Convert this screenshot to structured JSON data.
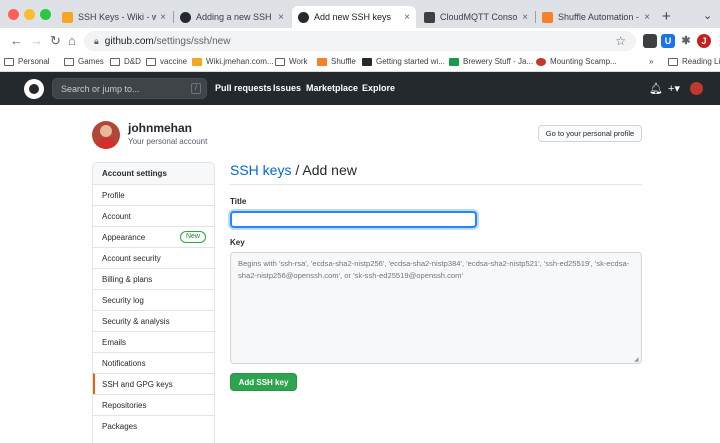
{
  "browser": {
    "tabs": [
      {
        "label": "SSH Keys - Wiki - wiki.jme",
        "icon_color": "#f5a623"
      },
      {
        "label": "Adding a new SSH key to y",
        "icon_color": "#24292e"
      },
      {
        "label": "Add new SSH keys",
        "icon_color": "#24292e",
        "active": true
      },
      {
        "label": "CloudMQTT Console mikh",
        "icon_color": "#3c4043"
      },
      {
        "label": "Shuffle Automation - An O",
        "icon_color": "#f5822a"
      }
    ],
    "close_glyph": "×",
    "new_tab_glyph": "+",
    "url_host": "github.com",
    "url_path": "/settings/ssh/new",
    "bookmarks": [
      {
        "label": "Personal",
        "kind": "folder"
      },
      {
        "label": "Games",
        "kind": "folder"
      },
      {
        "label": "D&D",
        "kind": "folder"
      },
      {
        "label": "vaccine",
        "kind": "folder"
      },
      {
        "label": "Wiki.jmehan.com...",
        "kind": "site",
        "color": "#f5a623"
      },
      {
        "label": "Work",
        "kind": "folder"
      },
      {
        "label": "Shuffle",
        "kind": "site",
        "color": "#f5822a"
      },
      {
        "label": "Getting started wi...",
        "kind": "site",
        "color": "#24292e"
      },
      {
        "label": "Brewery Stuff - Ja...",
        "kind": "site",
        "color": "#1a9b4b"
      },
      {
        "label": "Mounting Scamp...",
        "kind": "site",
        "color": "#c0392b"
      }
    ],
    "bookmarks_overflow": "»",
    "reading_list": "Reading List",
    "profile_initial": "J"
  },
  "github": {
    "search_placeholder": "Search or jump to...",
    "search_shortcut": "/",
    "nav": [
      "Pull requests",
      "Issues",
      "Marketplace",
      "Explore"
    ],
    "accent": "#0366d6"
  },
  "profile": {
    "username": "johnmehan",
    "subtitle": "Your personal account",
    "profile_button": "Go to your personal profile"
  },
  "sidebar": {
    "header": "Account settings",
    "items": [
      {
        "label": "Profile"
      },
      {
        "label": "Account"
      },
      {
        "label": "Appearance",
        "badge": "New"
      },
      {
        "label": "Account security"
      },
      {
        "label": "Billing & plans"
      },
      {
        "label": "Security log"
      },
      {
        "label": "Security & analysis"
      },
      {
        "label": "Emails"
      },
      {
        "label": "Notifications"
      },
      {
        "label": "SSH and GPG keys",
        "selected": true
      },
      {
        "label": "Repositories"
      },
      {
        "label": "Packages"
      }
    ]
  },
  "form": {
    "breadcrumb_link": "SSH keys",
    "breadcrumb_rest": " / Add new",
    "title_label": "Title",
    "title_value": "",
    "key_label": "Key",
    "key_placeholder": "Begins with 'ssh-rsa', 'ecdsa-sha2-nistp256', 'ecdsa-sha2-nistp384', 'ecdsa-sha2-nistp521', 'ssh-ed25519', 'sk-ecdsa-sha2-nistp256@openssh.com', or 'sk-ssh-ed25519@openssh.com'",
    "submit_label": "Add SSH key",
    "submit_color": "#2ea44f"
  }
}
